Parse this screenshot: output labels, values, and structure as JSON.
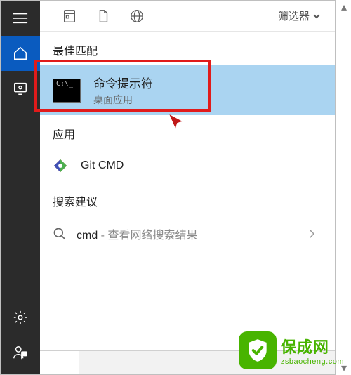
{
  "header": {
    "filter_label": "筛选器"
  },
  "sections": {
    "best_match_label": "最佳匹配",
    "apps_label": "应用",
    "suggestions_label": "搜索建议"
  },
  "best_match": {
    "title": "命令提示符",
    "subtitle": "桌面应用",
    "icon_text": "C:\\_"
  },
  "apps": [
    {
      "icon": "git-diamond-icon",
      "label": "Git CMD"
    }
  ],
  "suggestions": [
    {
      "query": "cmd",
      "secondary": " - 查看网络搜索结果"
    }
  ],
  "search": {
    "placeholder": ""
  },
  "watermark": {
    "brand": "保成网",
    "url": "zsbaocheng.com"
  }
}
